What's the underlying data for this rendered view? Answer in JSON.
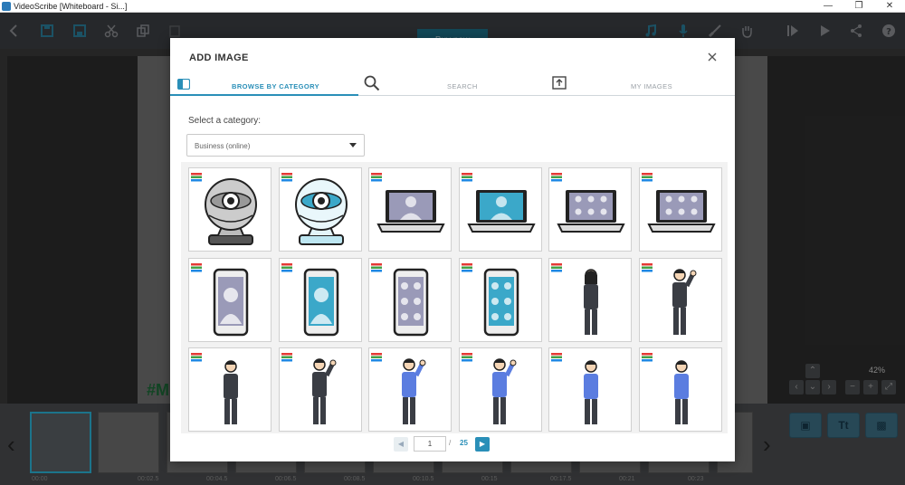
{
  "window": {
    "title": "VideoScribe [Whiteboard - Si...]"
  },
  "toolbar": {
    "buy_now_label": "Buy now"
  },
  "stage": {
    "hash_text": "#M",
    "zoom_label": "42%"
  },
  "timeline": {
    "times": [
      "00:00",
      "00:02.5",
      "00:04.5",
      "00:06.5",
      "00:08.5",
      "00:10.5",
      "00:15",
      "00:17.5",
      "00:21",
      "00:23"
    ],
    "tools": {
      "text_label": "Tt"
    }
  },
  "modal": {
    "title": "ADD IMAGE",
    "tabs": [
      {
        "label": "BROWSE BY CATEGORY",
        "active": true
      },
      {
        "label": "SEARCH",
        "active": false
      },
      {
        "label": "MY IMAGES",
        "active": false
      }
    ],
    "category_label": "Select a category:",
    "category_value": "Business (online)",
    "grid": [
      "webcam",
      "webcam",
      "laptop-call-single",
      "laptop-call-single",
      "laptop-call-group",
      "laptop-call-group",
      "phone-call-single",
      "phone-call-single",
      "phone-call-group",
      "phone-call-group",
      "woman-standing",
      "man-waving",
      "man-standing",
      "man-waving",
      "man-waving",
      "man-waving",
      "man-standing",
      "man-standing"
    ],
    "pager": {
      "current": "1",
      "separator": "/",
      "total": "25"
    }
  },
  "colors": {
    "accent": "#2a8fb8",
    "illustration_blue": "#3ba8c9",
    "toolbar": "#3b3e42",
    "overlay_dark": "#2c2c2c"
  }
}
